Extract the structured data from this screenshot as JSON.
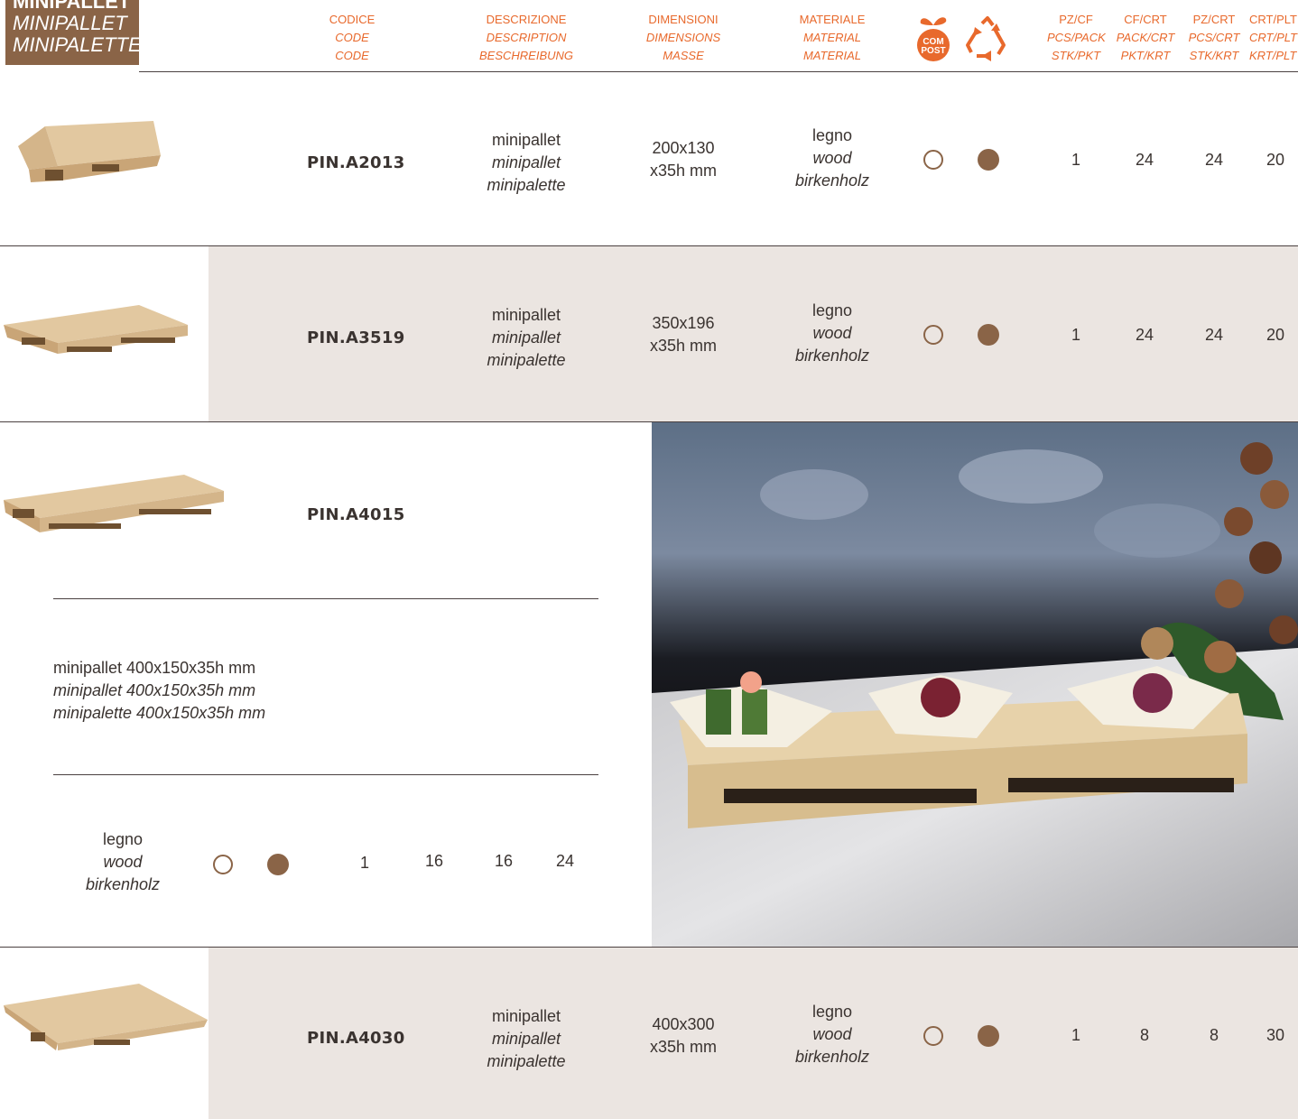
{
  "title": [
    "MINIPALLET",
    "MINIPALLET",
    "MINIPALETTE"
  ],
  "headers": {
    "codice": [
      "CODICE",
      "CODE",
      "CODE"
    ],
    "descrizione": [
      "DESCRIZIONE",
      "DESCRIPTION",
      "BESCHREIBUNG"
    ],
    "dimensioni": [
      "DIMENSIONI",
      "DIMENSIONS",
      "MASSE"
    ],
    "materiale": [
      "MATERIALE",
      "MATERIAL",
      "MATERIAL"
    ],
    "compost_icon_text": [
      "COM",
      "POST"
    ],
    "pz_cf": [
      "PZ/CF",
      "PCS/PACK",
      "STK/PKT"
    ],
    "cf_crt": [
      "CF/CRT",
      "PACK/CRT",
      "PKT/KRT"
    ],
    "pz_crt": [
      "PZ/CRT",
      "PCS/CRT",
      "STK/KRT"
    ],
    "crt_plt": [
      "CRT/PLT",
      "CRT/PLT",
      "KRT/PLT"
    ]
  },
  "products": [
    {
      "code": "PIN.A2013",
      "desc": [
        "minipallet",
        "minipallet",
        "minipalette"
      ],
      "dims": [
        "200x130",
        "x35h mm"
      ],
      "material": [
        "legno",
        "wood",
        "birkenholz"
      ],
      "pz_cf": "1",
      "cf_crt": "24",
      "pz_crt": "24",
      "crt_plt": "20"
    },
    {
      "code": "PIN.A3519",
      "desc": [
        "minipallet",
        "minipallet",
        "minipalette"
      ],
      "dims": [
        "350x196",
        "x35h mm"
      ],
      "material": [
        "legno",
        "wood",
        "birkenholz"
      ],
      "pz_cf": "1",
      "cf_crt": "24",
      "pz_crt": "24",
      "crt_plt": "20"
    },
    {
      "code": "PIN.A4015",
      "desc_line": [
        "minipallet 400x150x35h mm",
        "minipallet 400x150x35h mm",
        "minipalette 400x150x35h mm"
      ],
      "material": [
        "legno",
        "wood",
        "birkenholz"
      ],
      "pz_cf": "1",
      "cf_crt": "16",
      "pz_crt": "16",
      "crt_plt": "24"
    },
    {
      "code": "PIN.A4030",
      "desc": [
        "minipallet",
        "minipallet",
        "minipalette"
      ],
      "dims": [
        "400x300",
        "x35h mm"
      ],
      "material": [
        "legno",
        "wood",
        "birkenholz"
      ],
      "pz_cf": "1",
      "cf_crt": "8",
      "pz_crt": "8",
      "crt_plt": "30"
    }
  ],
  "colors": {
    "brand_brown": "#8a6447",
    "header_orange": "#e8692c",
    "band": "#ebe5e1"
  },
  "icons": [
    "compost-icon",
    "recycle-icon",
    "compostable-empty-circle-icon",
    "recyclable-filled-circle-icon"
  ]
}
